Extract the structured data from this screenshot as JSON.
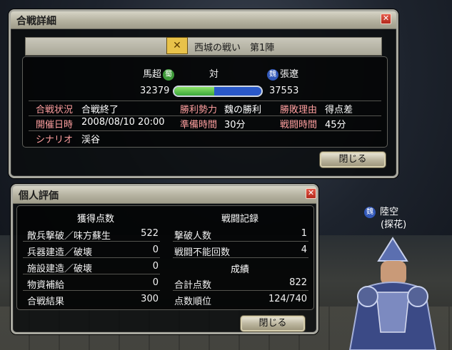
{
  "battle_window": {
    "title": "合戦詳細",
    "battle_name": "西城の戦い　第1陣",
    "commander_left": "馬超",
    "faction_left": "蜀",
    "vs": "対",
    "faction_right": "魏",
    "commander_right": "張遼",
    "score_left": "32379",
    "score_right": "37553",
    "score_ratio_left": 0.463,
    "rows": [
      {
        "label": "合戦状況",
        "value": "合戦終了"
      },
      {
        "label": "勝利勢力",
        "value": "魏の勝利"
      },
      {
        "label": "勝敗理由",
        "value": "得点差"
      },
      {
        "label": "開催日時",
        "value": "2008/08/10 20:00"
      },
      {
        "label": "準備時間",
        "value": "30分"
      },
      {
        "label": "戦闘時間",
        "value": "45分"
      },
      {
        "label": "シナリオ",
        "value": "渓谷"
      }
    ],
    "close_label": "閉じる"
  },
  "eval_window": {
    "title": "個人評価",
    "left_header": "獲得点数",
    "left_rows": [
      {
        "label": "敵兵撃破／味方蘇生",
        "value": "522"
      },
      {
        "label": "兵器建造／破壊",
        "value": "0"
      },
      {
        "label": "施設建造／破壊",
        "value": "0"
      },
      {
        "label": "物資補給",
        "value": "0"
      },
      {
        "label": "合戦結果",
        "value": "300"
      }
    ],
    "right_header1": "戦闘記録",
    "right_rows1": [
      {
        "label": "撃破人数",
        "value": "1"
      },
      {
        "label": "戦闘不能回数",
        "value": "4"
      }
    ],
    "right_header2": "成績",
    "right_rows2": [
      {
        "label": "合計点数",
        "value": "822"
      },
      {
        "label": "点数順位",
        "value": "124/740"
      }
    ],
    "close_label": "閉じる"
  },
  "player": {
    "name": "陸空",
    "faction": "魏",
    "tag": "(探花)"
  },
  "colors": {
    "label": "#ff9f9f",
    "bar_green": "#3aa63a",
    "bar_blue": "#2a58c8"
  }
}
